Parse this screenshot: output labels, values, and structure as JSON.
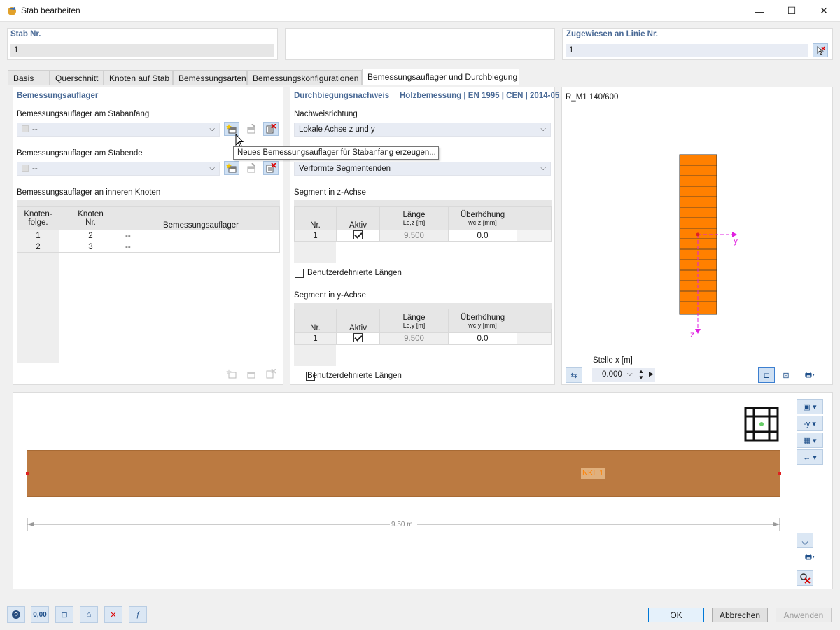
{
  "window": {
    "title": "Stab bearbeiten",
    "minimize": "—",
    "maximize": "☐",
    "close": "✕"
  },
  "header": {
    "member_label": "Stab Nr.",
    "member_value": "1",
    "assigned_label": "Zugewiesen an Linie Nr.",
    "assigned_value": "1"
  },
  "tabs": [
    "Basis",
    "Querschnitt",
    "Knoten auf Stab",
    "Bemessungsarten",
    "Bemessungskonfigurationen",
    "Bemessungsauflager und Durchbiegung"
  ],
  "supports": {
    "title": "Bemessungsauflager",
    "start_label": "Bemessungsauflager am Stabanfang",
    "start_value": "--",
    "end_label": "Bemessungsauflager am Stabende",
    "end_value": "--",
    "inner_label": "Bemessungsauflager an inneren Knoten",
    "tooltip": "Neues Bemessungsauflager für Stabanfang erzeugen...",
    "table": {
      "col1a": "Knoten-",
      "col1b": "folge.",
      "col2a": "Knoten",
      "col2b": "Nr.",
      "col3": "Bemessungsauflager",
      "rows": [
        {
          "seq": "1",
          "node": "2",
          "support": "--"
        },
        {
          "seq": "2",
          "node": "3",
          "support": "--"
        }
      ]
    }
  },
  "deflection": {
    "title": "Durchbiegungsnachweis",
    "standard": "Holzbemessung | EN 1995 | CEN | 2014-05",
    "direction_label": "Nachweisrichtung",
    "direction_value": "Lokale Achse z und y",
    "reference_value": "Verformte Segmentenden",
    "seg_z_label": "Segment in z-Achse",
    "seg_y_label": "Segment in y-Achse",
    "col_nr": "Nr.",
    "col_active": "Aktiv",
    "col_length": "Länge",
    "col_length_z_unit": "Lc,z [m]",
    "col_length_y_unit": "Lc,y [m]",
    "col_camber": "Überhöhung",
    "col_camber_z_unit": "wc,z [mm]",
    "col_camber_y_unit": "wc,y [mm]",
    "z_row": {
      "nr": "1",
      "active": true,
      "length": "9.500",
      "camber": "0.0"
    },
    "y_row": {
      "nr": "1",
      "active": true,
      "length": "9.500",
      "camber": "0.0"
    },
    "user_lengths_label": "Benutzerdefinierte Längen"
  },
  "section": {
    "name": "R_M1 140/600",
    "axis_y": "y",
    "axis_z": "z",
    "station_label": "Stelle x [m]",
    "station_value": "0.000"
  },
  "member_view": {
    "label": "NKL 1",
    "dimension": "9.50 m"
  },
  "footer": {
    "ok": "OK",
    "cancel": "Abbrechen",
    "apply": "Anwenden",
    "units_btn": "0,00"
  },
  "colors": {
    "section_fill": "#ff8000",
    "member_fill": "#bb7a41",
    "axis": "#e020e0",
    "accent": "#4a6a96"
  },
  "icons": [
    "help-icon",
    "units-icon",
    "info-icon",
    "view-icon",
    "delete-icon",
    "formula-icon",
    "new-support-icon",
    "edit-support-icon",
    "delete-support-icon",
    "dropdown-icon"
  ]
}
